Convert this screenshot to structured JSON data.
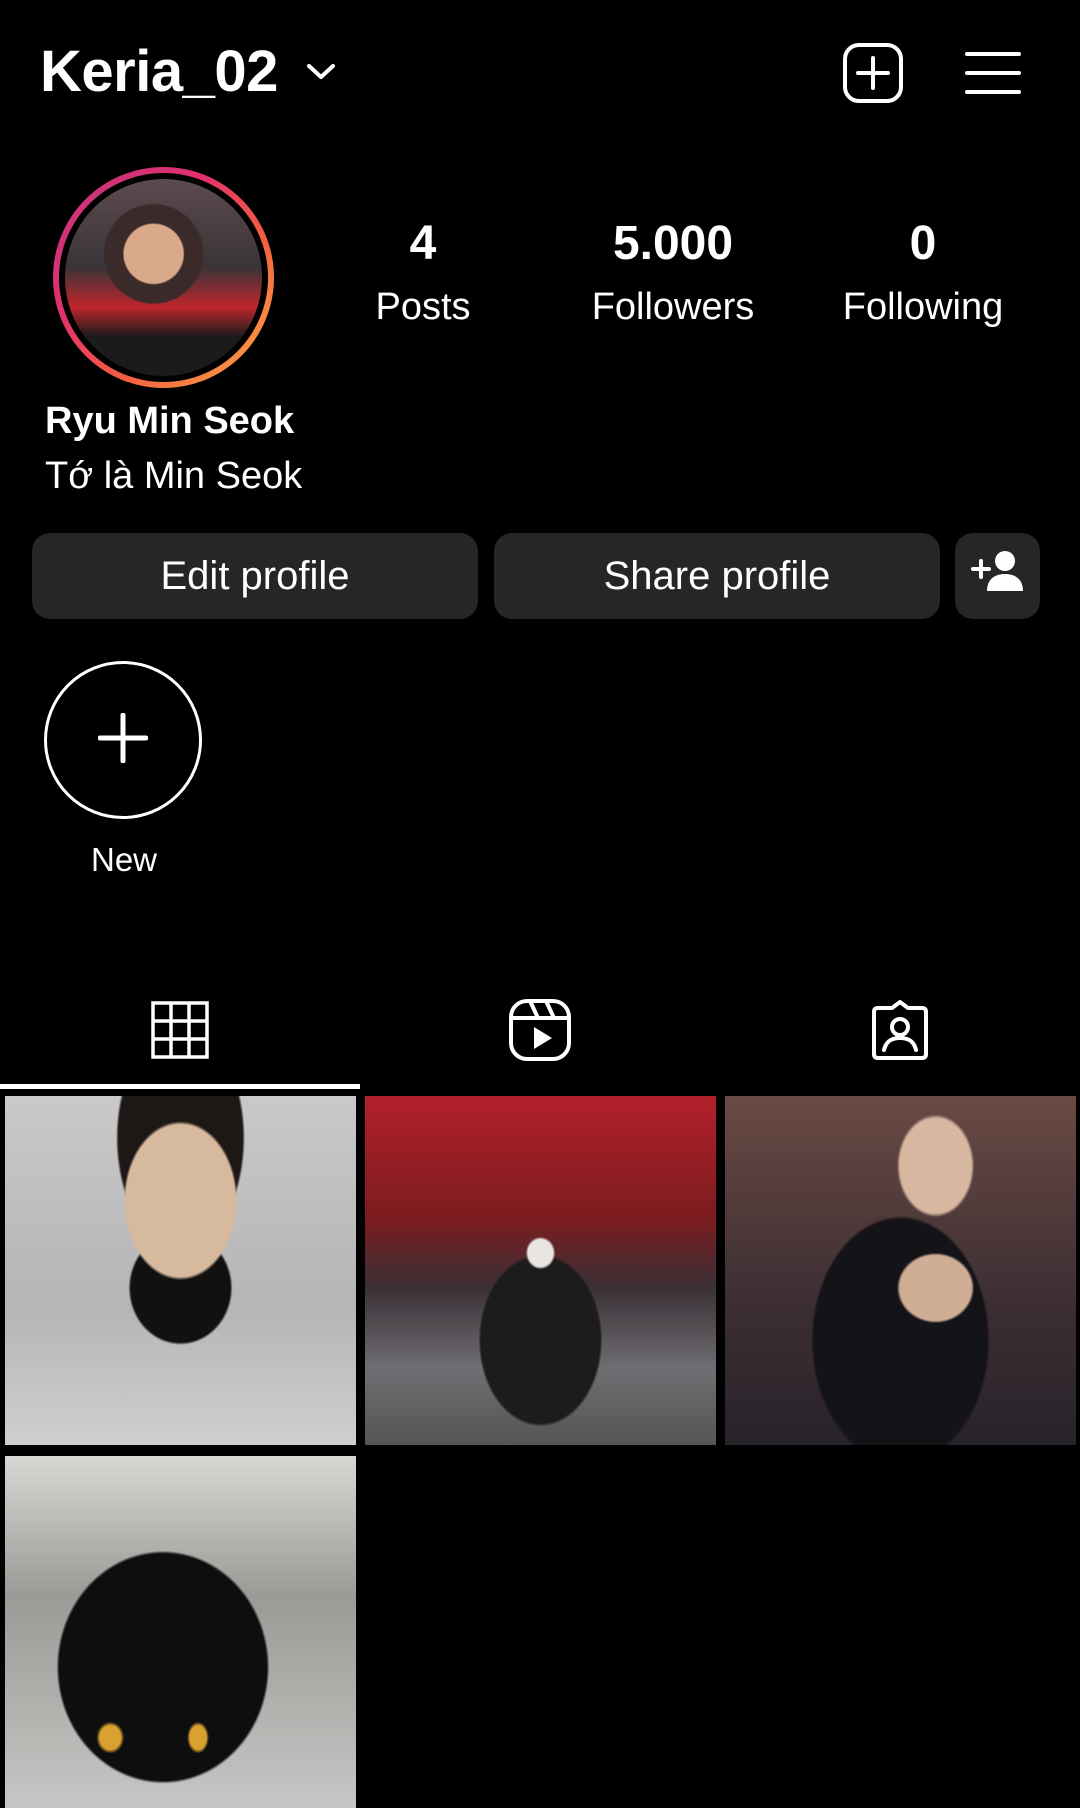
{
  "header": {
    "username": "Keria_02",
    "icons": {
      "dropdown": "chevron-down-icon",
      "add": "plus-square-icon",
      "menu": "hamburger-menu-icon"
    }
  },
  "profile": {
    "display_name": "Ryu Min Seok",
    "bio": "Tớ là Min Seok",
    "stats": {
      "posts": {
        "value": "4",
        "label": "Posts"
      },
      "followers": {
        "value": "5.000",
        "label": "Followers"
      },
      "following": {
        "value": "0",
        "label": "Following"
      }
    }
  },
  "actions": {
    "edit_label": "Edit profile",
    "share_label": "Share profile",
    "add_user_icon": "add-user-icon"
  },
  "highlights": {
    "new_label": "New"
  },
  "tabs": [
    {
      "icon": "grid-icon",
      "selected": true
    },
    {
      "icon": "reels-icon",
      "selected": false
    },
    {
      "icon": "tagged-icon",
      "selected": false
    }
  ],
  "colors": {
    "background": "#000000",
    "button_bg": "#262626",
    "ring_start": "#c13584",
    "ring_end": "#fcaf45"
  }
}
